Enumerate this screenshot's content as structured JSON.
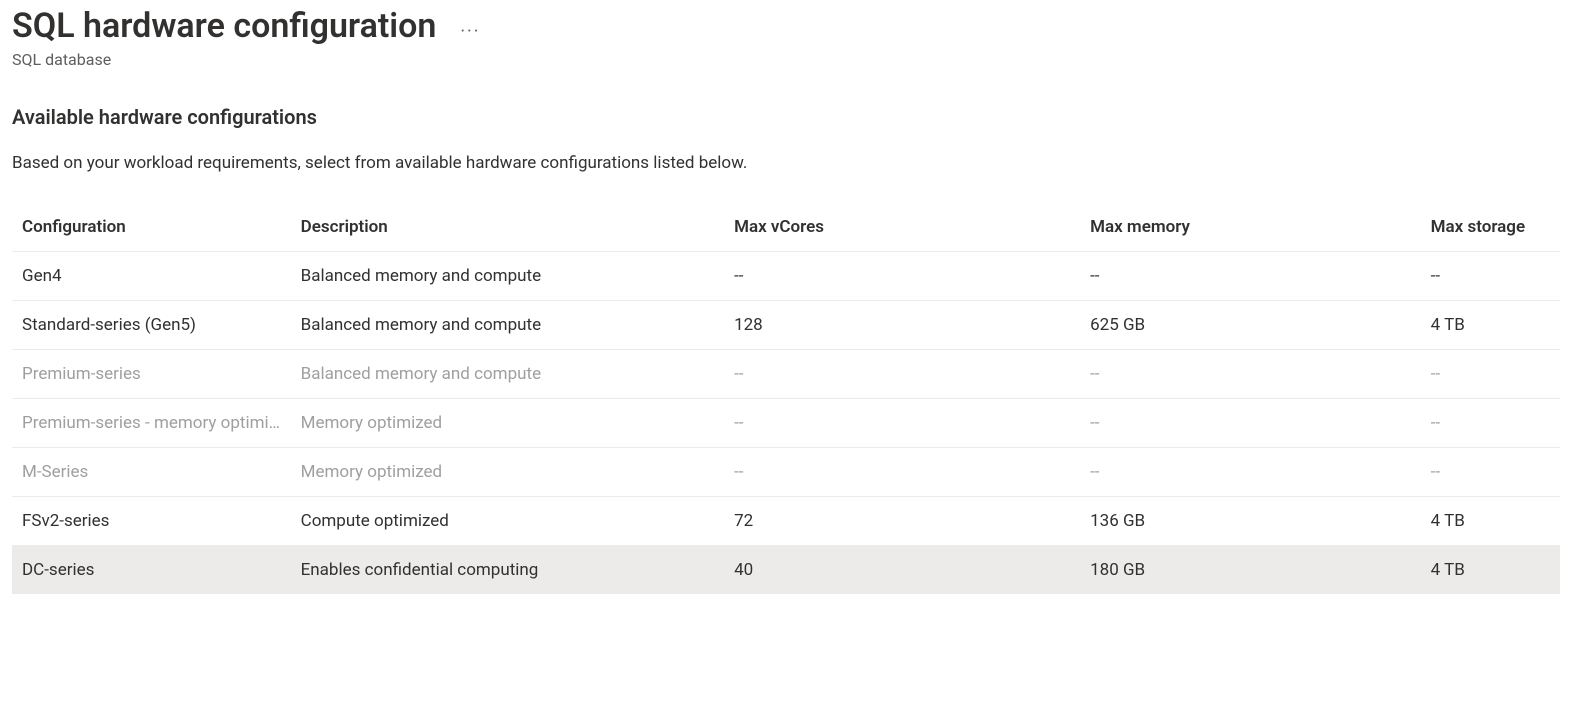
{
  "header": {
    "title": "SQL hardware configuration",
    "subtitle": "SQL database"
  },
  "section": {
    "heading": "Available hardware configurations",
    "description": "Based on your workload requirements, select from available hardware configurations listed below."
  },
  "table": {
    "columns": [
      "Configuration",
      "Description",
      "Max vCores",
      "Max memory",
      "Max storage"
    ],
    "rows": [
      {
        "config": "Gen4",
        "desc": "Balanced memory and compute",
        "vcores": "--",
        "memory": "--",
        "storage": "--",
        "disabled": false,
        "selected": false
      },
      {
        "config": "Standard-series (Gen5)",
        "desc": "Balanced memory and compute",
        "vcores": "128",
        "memory": "625 GB",
        "storage": "4 TB",
        "disabled": false,
        "selected": false
      },
      {
        "config": "Premium-series",
        "desc": "Balanced memory and compute",
        "vcores": "--",
        "memory": "--",
        "storage": "--",
        "disabled": true,
        "selected": false
      },
      {
        "config": "Premium-series - memory optimized",
        "desc": "Memory optimized",
        "vcores": "--",
        "memory": "--",
        "storage": "--",
        "disabled": true,
        "selected": false
      },
      {
        "config": "M-Series",
        "desc": "Memory optimized",
        "vcores": "--",
        "memory": "--",
        "storage": "--",
        "disabled": true,
        "selected": false
      },
      {
        "config": "FSv2-series",
        "desc": "Compute optimized",
        "vcores": "72",
        "memory": "136 GB",
        "storage": "4 TB",
        "disabled": false,
        "selected": false
      },
      {
        "config": "DC-series",
        "desc": "Enables confidential computing",
        "vcores": "40",
        "memory": "180 GB",
        "storage": "4 TB",
        "disabled": false,
        "selected": true
      }
    ]
  }
}
